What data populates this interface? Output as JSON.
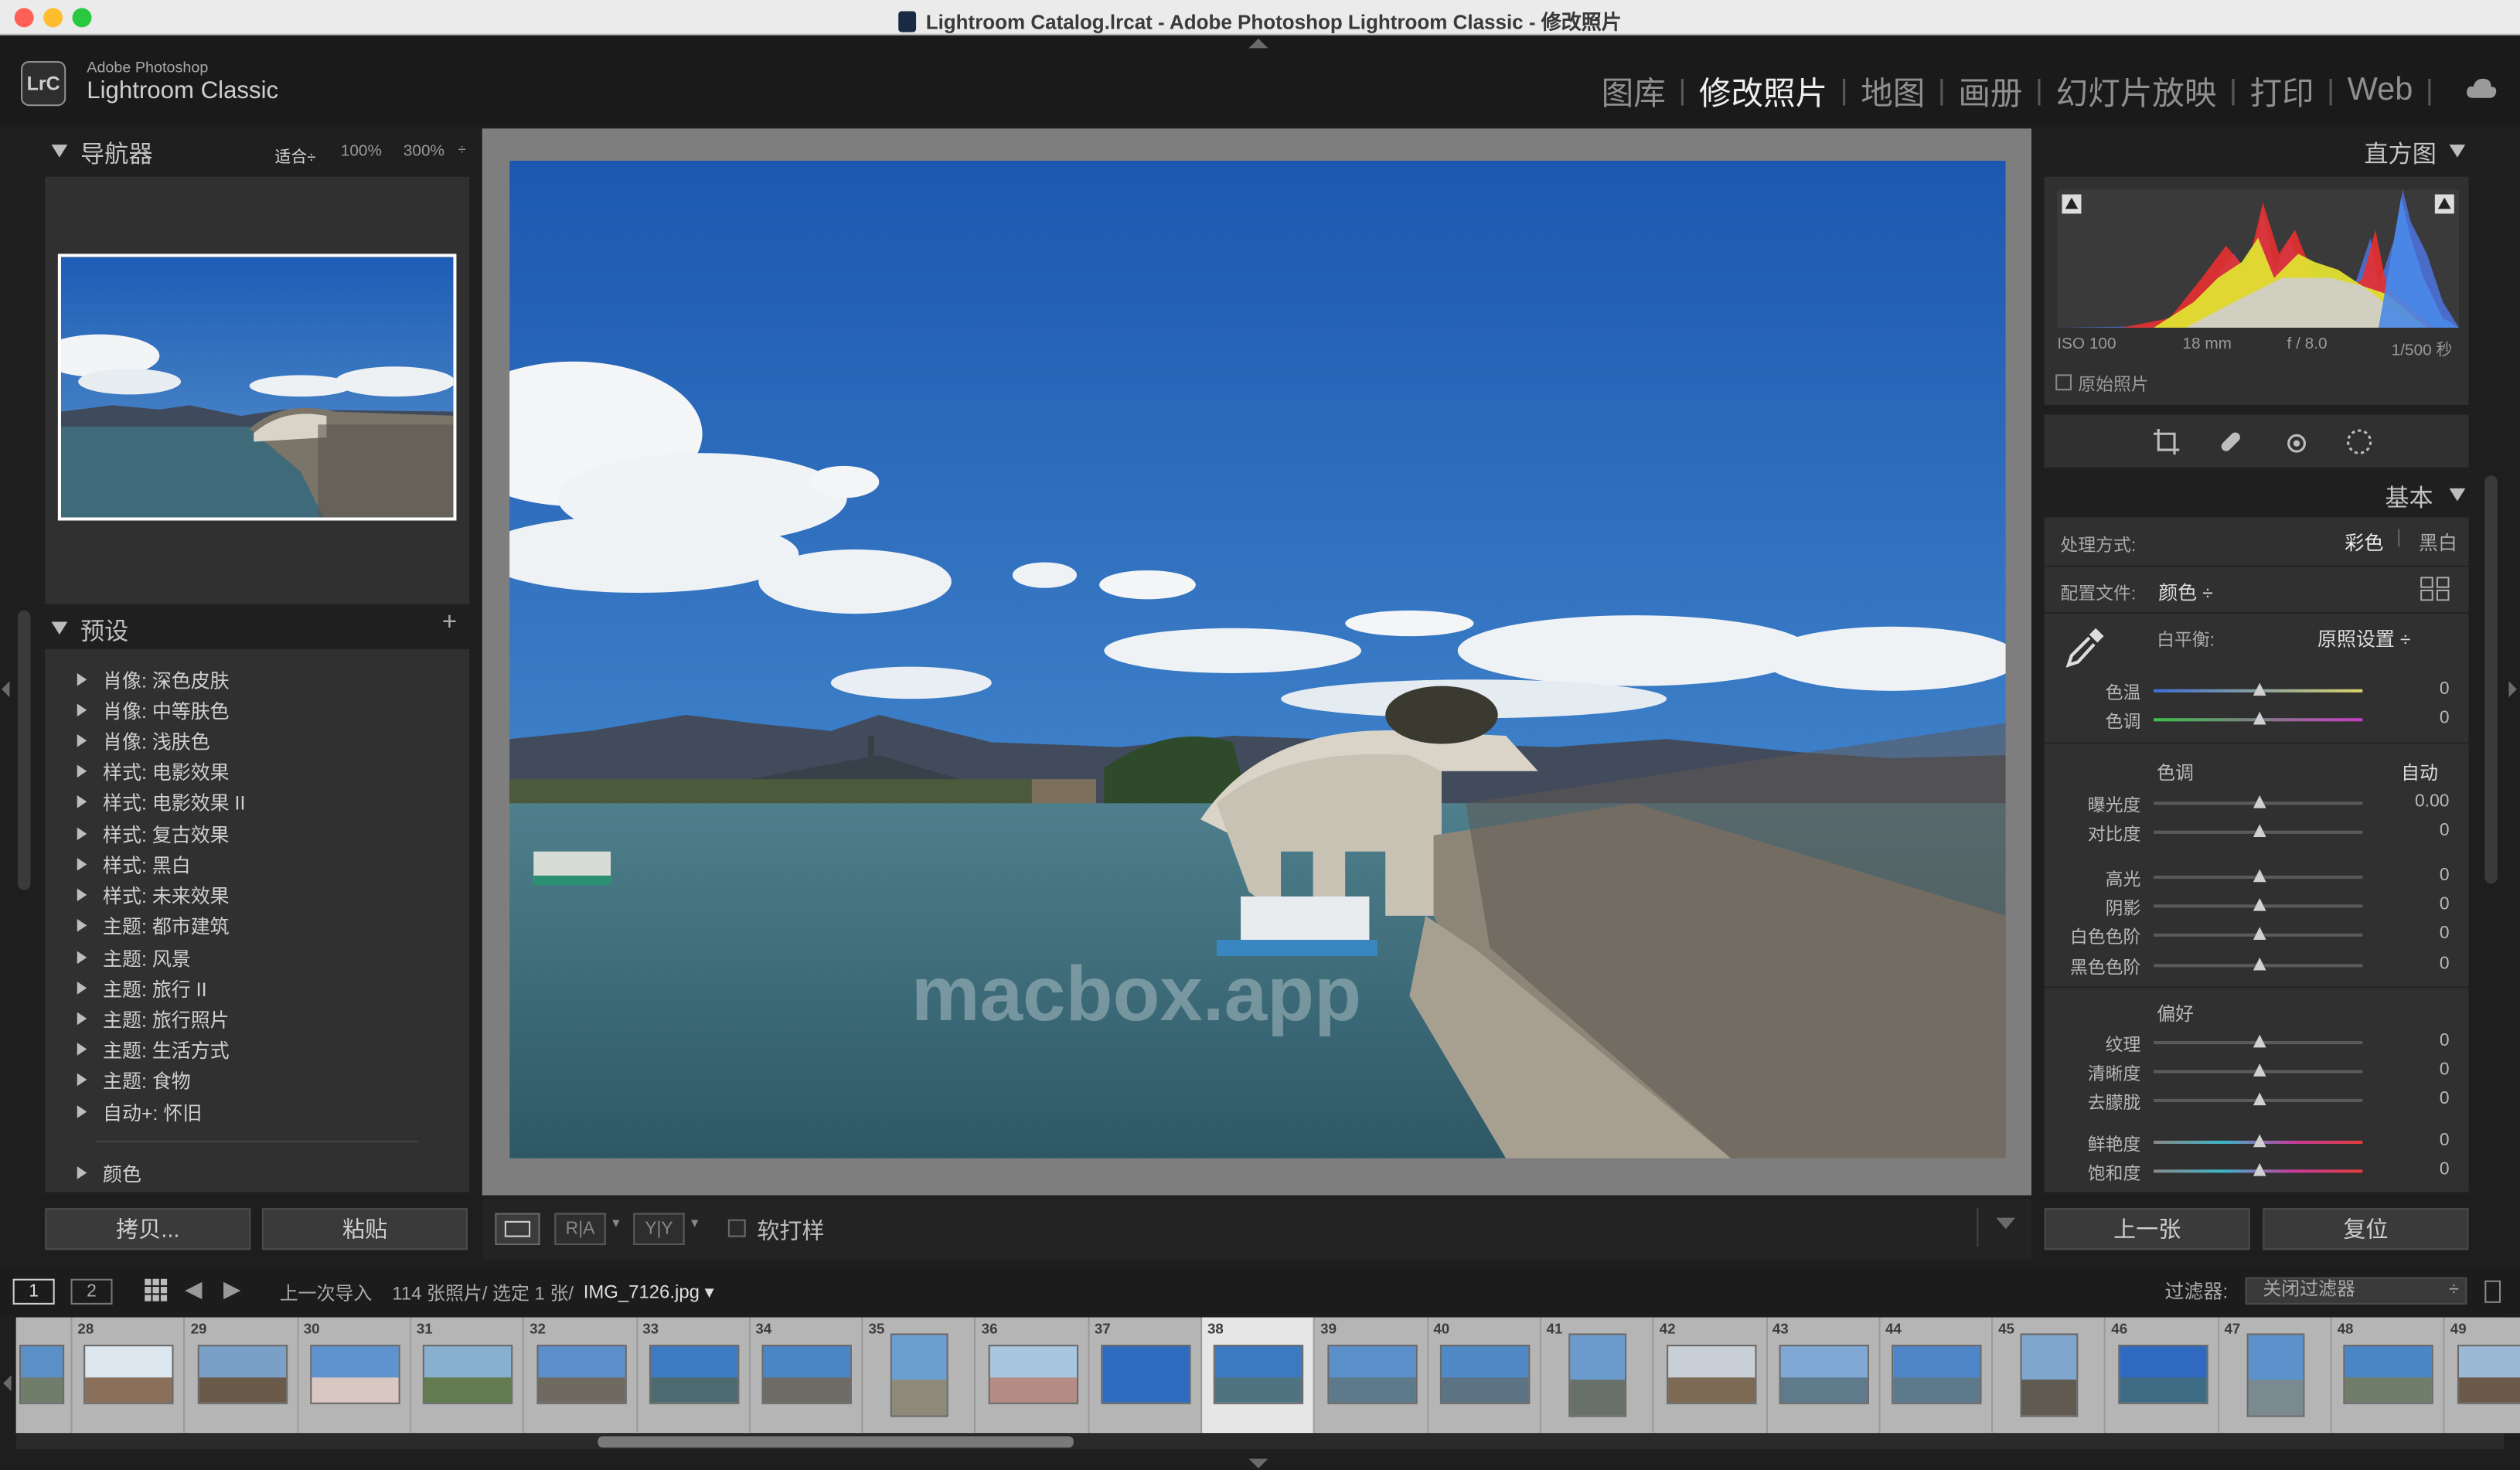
{
  "window": {
    "title": "Lightroom Catalog.lrcat - Adobe Photoshop Lightroom Classic - 修改照片"
  },
  "brand": {
    "small": "Adobe Photoshop",
    "big": "Lightroom Classic",
    "logo": "LrC"
  },
  "modules": [
    {
      "label": "图库",
      "active": false
    },
    {
      "label": "修改照片",
      "active": true
    },
    {
      "label": "地图",
      "active": false
    },
    {
      "label": "画册",
      "active": false
    },
    {
      "label": "幻灯片放映",
      "active": false
    },
    {
      "label": "打印",
      "active": false
    },
    {
      "label": "Web",
      "active": false
    }
  ],
  "navigator": {
    "title": "导航器",
    "fit": "适合",
    "zoom100": "100%",
    "zoom300": "300%"
  },
  "presets": {
    "title": "预设",
    "add": "+",
    "items": [
      "肖像: 深色皮肤",
      "肖像: 中等肤色",
      "肖像: 浅肤色",
      "样式: 电影效果",
      "样式: 电影效果 II",
      "样式: 复古效果",
      "样式: 黑白",
      "样式: 未来效果",
      "主题: 都市建筑",
      "主题: 风景",
      "主题: 旅行 II",
      "主题: 旅行照片",
      "主题: 生活方式",
      "主题: 食物",
      "自动+: 怀旧"
    ],
    "last": "颜色"
  },
  "left_buttons": {
    "copy": "拷贝...",
    "paste": "粘贴"
  },
  "toolbar": {
    "ra": "R|A",
    "yy": "Y|Y",
    "soft_proof": "软打样"
  },
  "photo": {
    "watermark": "macbox.app"
  },
  "histogram": {
    "title": "直方图",
    "iso": "ISO 100",
    "focal": "18 mm",
    "aperture": "f / 8.0",
    "shutter": "1/500 秒",
    "original": "原始照片"
  },
  "basic": {
    "title": "基本",
    "treatment_label": "处理方式:",
    "color": "彩色",
    "bw": "黑白",
    "profile_label": "配置文件:",
    "profile_value": "颜色",
    "wb_label": "白平衡:",
    "wb_value": "原照设置",
    "tone_label": "色调",
    "auto": "自动",
    "presence_label": "偏好",
    "sliders": [
      {
        "label": "色温",
        "value": "0"
      },
      {
        "label": "色调",
        "value": "0"
      },
      {
        "label": "曝光度",
        "value": "0.00"
      },
      {
        "label": "对比度",
        "value": "0"
      },
      {
        "label": "高光",
        "value": "0"
      },
      {
        "label": "阴影",
        "value": "0"
      },
      {
        "label": "白色色阶",
        "value": "0"
      },
      {
        "label": "黑色色阶",
        "value": "0"
      },
      {
        "label": "纹理",
        "value": "0"
      },
      {
        "label": "清晰度",
        "value": "0"
      },
      {
        "label": "去朦胧",
        "value": "0"
      },
      {
        "label": "鲜艳度",
        "value": "0"
      },
      {
        "label": "饱和度",
        "value": "0"
      }
    ]
  },
  "right_buttons": {
    "prev": "上一张",
    "reset": "复位"
  },
  "filmbar": {
    "screen1": "1",
    "screen2": "2",
    "source": "上一次导入",
    "count": "114 张照片/ 选定 1 张/",
    "file": "IMG_7126.jpg",
    "filter_label": "过滤器:",
    "filter_value": "关闭过滤器"
  },
  "filmstrip": {
    "numbers": [
      "",
      "28",
      "29",
      "30",
      "31",
      "32",
      "33",
      "34",
      "35",
      "36",
      "37",
      "38",
      "39",
      "40",
      "41",
      "42",
      "43",
      "44",
      "45",
      "46",
      "47",
      "48",
      "49"
    ],
    "selected": "38"
  }
}
